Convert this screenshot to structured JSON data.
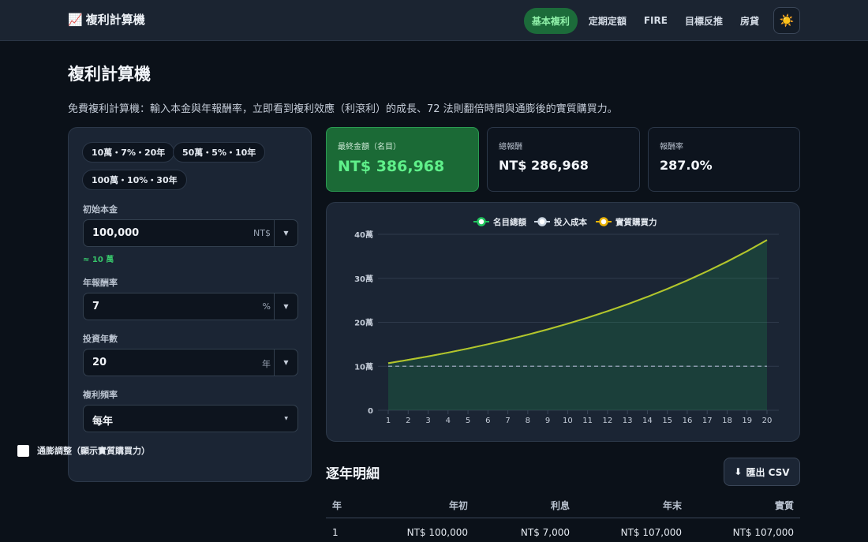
{
  "header": {
    "logo_icon": "chart-increasing-icon",
    "brand": "複利計算機",
    "nav": [
      {
        "label": "基本複利",
        "active": true
      },
      {
        "label": "定期定額",
        "active": false
      },
      {
        "label": "FIRE",
        "active": false
      },
      {
        "label": "目標反推",
        "active": false
      },
      {
        "label": "房貸",
        "active": false
      }
    ],
    "theme_icon": "sun-icon"
  },
  "page": {
    "title": "複利計算機",
    "description": "免費複利計算機：輸入本金與年報酬率，立即看到複利效應（利滾利）的成長、72 法則翻倍時間與通膨後的實質購買力。"
  },
  "form": {
    "presets": [
      "10萬・7%・20年",
      "50萬・5%・10年",
      "100萬・10%・30年"
    ],
    "principal": {
      "label": "初始本金",
      "value": "100,000",
      "unit": "NT$",
      "hint": "≈ 10 萬"
    },
    "rate": {
      "label": "年報酬率",
      "value": "7",
      "unit": "%"
    },
    "years": {
      "label": "投資年數",
      "value": "20",
      "unit": "年"
    },
    "frequency": {
      "label": "複利頻率",
      "value": "每年"
    },
    "inflation": {
      "label": "通膨調整（顯示實質購買力）",
      "checked": false
    }
  },
  "stats": [
    {
      "label": "最終金額（名目）",
      "value": "NT$ 386,968"
    },
    {
      "label": "總報酬",
      "value": "NT$ 286,968"
    },
    {
      "label": "報酬率",
      "value": "287.0%"
    }
  ],
  "chart_data": {
    "type": "line",
    "x": [
      1,
      2,
      3,
      4,
      5,
      6,
      7,
      8,
      9,
      10,
      11,
      12,
      13,
      14,
      15,
      16,
      17,
      18,
      19,
      20
    ],
    "y_ticks": [
      "0",
      "10萬",
      "20萬",
      "30萬",
      "40萬"
    ],
    "ylim": [
      0,
      400000
    ],
    "grid": true,
    "legend_position": "top",
    "series": [
      {
        "name": "名目總額",
        "color": "#22c55e",
        "fill": true,
        "values": [
          107000,
          114490,
          122504,
          131080,
          140255,
          150073,
          160578,
          171819,
          183846,
          196715,
          210485,
          225219,
          240985,
          257853,
          275903,
          295216,
          315882,
          337993,
          361653,
          386968
        ]
      },
      {
        "name": "投入成本",
        "color": "#cbd5e1",
        "dashed": true,
        "values": [
          100000,
          100000,
          100000,
          100000,
          100000,
          100000,
          100000,
          100000,
          100000,
          100000,
          100000,
          100000,
          100000,
          100000,
          100000,
          100000,
          100000,
          100000,
          100000,
          100000
        ]
      },
      {
        "name": "實質購買力",
        "color": "#eab308",
        "values": [
          107000,
          114490,
          122504,
          131080,
          140255,
          150073,
          160578,
          171819,
          183846,
          196715,
          210485,
          225219,
          240985,
          257853,
          275903,
          295216,
          315882,
          337993,
          361653,
          386968
        ]
      }
    ]
  },
  "table": {
    "title": "逐年明細",
    "export_label": "匯出 CSV",
    "export_icon": "download-arrow-icon",
    "headers": [
      "年",
      "年初",
      "利息",
      "年末",
      "實質"
    ],
    "rows": [
      [
        "1",
        "NT$ 100,000",
        "NT$ 7,000",
        "NT$ 107,000",
        "NT$ 107,000"
      ]
    ]
  }
}
